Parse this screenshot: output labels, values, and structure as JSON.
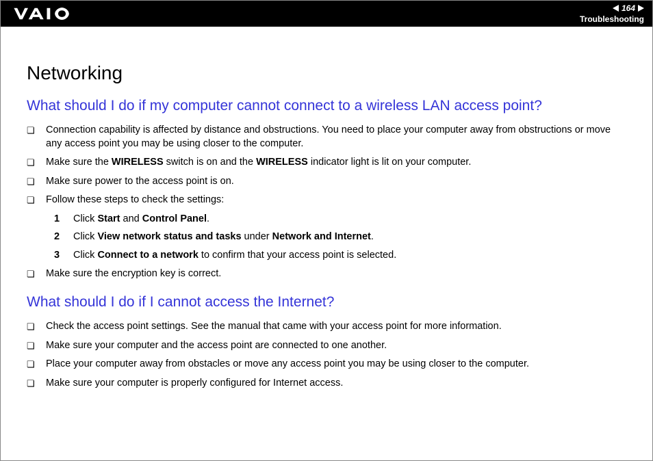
{
  "header": {
    "page_number": "164",
    "section": "Troubleshooting"
  },
  "title": "Networking",
  "q1": {
    "heading": "What should I do if my computer cannot connect to a wireless LAN access point?",
    "b1": "Connection capability is affected by distance and obstructions. You need to place your computer away from obstructions or move any access point you may be using closer to the computer.",
    "b2_pre": "Make sure the ",
    "b2_bold1": "WIRELESS",
    "b2_mid": " switch is on and the ",
    "b2_bold2": "WIRELESS",
    "b2_post": " indicator light is lit on your computer.",
    "b3": "Make sure power to the access point is on.",
    "b4": "Follow these steps to check the settings:",
    "s1_pre": "Click ",
    "s1_b1": "Start",
    "s1_mid": " and ",
    "s1_b2": "Control Panel",
    "s1_post": ".",
    "s2_pre": "Click ",
    "s2_b1": "View network status and tasks",
    "s2_mid": " under ",
    "s2_b2": "Network and Internet",
    "s2_post": ".",
    "s3_pre": "Click ",
    "s3_b1": "Connect to a network",
    "s3_post": " to confirm that your access point is selected.",
    "b5": "Make sure the encryption key is correct."
  },
  "q2": {
    "heading": "What should I do if I cannot access the Internet?",
    "b1": "Check the access point settings. See the manual that came with your access point for more information.",
    "b2": "Make sure your computer and the access point are connected to one another.",
    "b3": "Place your computer away from obstacles or move any access point you may be using closer to the computer.",
    "b4": "Make sure your computer is properly configured for Internet access."
  },
  "nums": {
    "n1": "1",
    "n2": "2",
    "n3": "3"
  },
  "bullet": "❏"
}
